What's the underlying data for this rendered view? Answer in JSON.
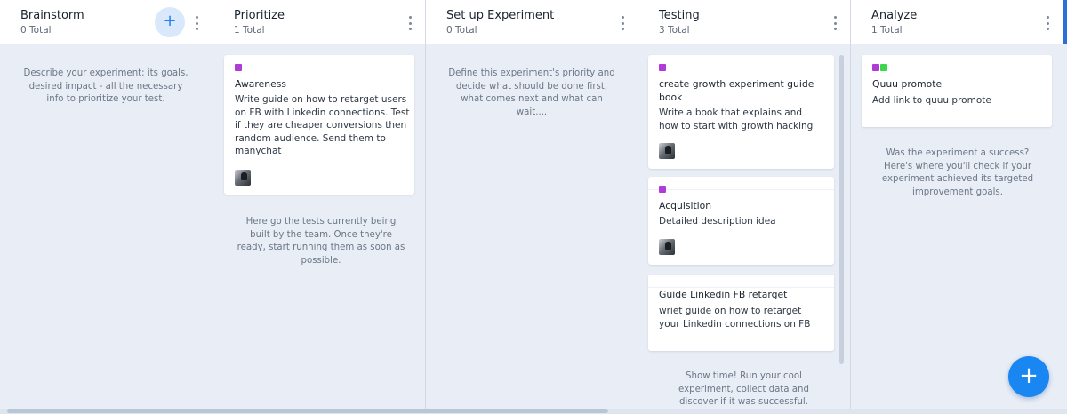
{
  "columns": [
    {
      "title": "Brainstorm",
      "count": "0 Total",
      "hint": "Describe your experiment: its goals, desired impact - all the necessary info to prioritize your test."
    },
    {
      "title": "Prioritize",
      "count": "1 Total",
      "hint": "Here go the tests currently being built by the team. Once they're ready, start running them as soon as possible.",
      "cards": [
        {
          "title": "Awareness",
          "description": "Write guide on how to retarget users on FB with Linkedin connections. Test if they are cheaper conversions then random audience. Send them to manychat"
        }
      ]
    },
    {
      "title": "Set up Experiment",
      "count": "0 Total",
      "hint": "Define this experiment's priority and decide what should be done first, what comes next and what can wait...."
    },
    {
      "title": "Testing",
      "count": "3 Total",
      "hint": "Show time! Run your cool experiment, collect data and discover if it was successful.",
      "cards": [
        {
          "title": "create growth experiment guide book",
          "description": "Write a book that explains and how to start with growth hacking"
        },
        {
          "title": "Acquisition",
          "description": "Detailed description idea"
        },
        {
          "title": "Guide Linkedin FB retarget",
          "description": "wriet guide on how to retarget your Linkedin connections on FB"
        }
      ]
    },
    {
      "title": "Analyze",
      "count": "1 Total",
      "hint": "Was the experiment a success? Here's where you'll check if your experiment achieved its targeted improvement goals.",
      "cards": [
        {
          "title": "Quuu promote",
          "description": "Add link to quuu promote"
        }
      ]
    }
  ],
  "add_column_button": "+",
  "fab_label": "+",
  "colors": {
    "tag_purple": "#b13bd6",
    "tag_green": "#3bd64a",
    "accent_blue": "#1a86f2"
  }
}
